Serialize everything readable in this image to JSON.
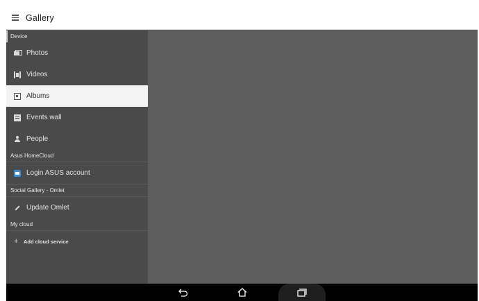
{
  "app_bar": {
    "title": "Gallery",
    "menu_icon": "hamburger-menu-icon"
  },
  "drawer": {
    "sections": [
      {
        "header": "Device",
        "items": [
          {
            "label": "Photos",
            "icon": "photos-icon"
          },
          {
            "label": "Videos",
            "icon": "videos-icon"
          },
          {
            "label": "Albums",
            "icon": "albums-icon",
            "selected": true
          },
          {
            "label": "Events wall",
            "icon": "events-wall-icon"
          },
          {
            "label": "People",
            "icon": "people-icon"
          }
        ]
      },
      {
        "header": "Asus HomeCloud",
        "items": [
          {
            "label": "Login ASUS account",
            "icon": "asus-cloud-icon"
          }
        ]
      },
      {
        "header": "Social Gallery - Omlet",
        "items": [
          {
            "label": "Update Omlet",
            "icon": "update-icon"
          }
        ]
      },
      {
        "header": "My cloud",
        "items": [
          {
            "label": "Add cloud service",
            "icon": "plus-icon"
          }
        ]
      }
    ]
  },
  "navigation_bar": {
    "buttons": [
      "back-icon",
      "home-icon",
      "recent-apps-icon"
    ]
  },
  "colors": {
    "content_background": "#5d5d5d",
    "drawer_background": "#4a4a4a",
    "selected_item_background": "#f3f3f3",
    "app_bar_background": "#ffffff",
    "navigation_bar_background": "#000000"
  }
}
